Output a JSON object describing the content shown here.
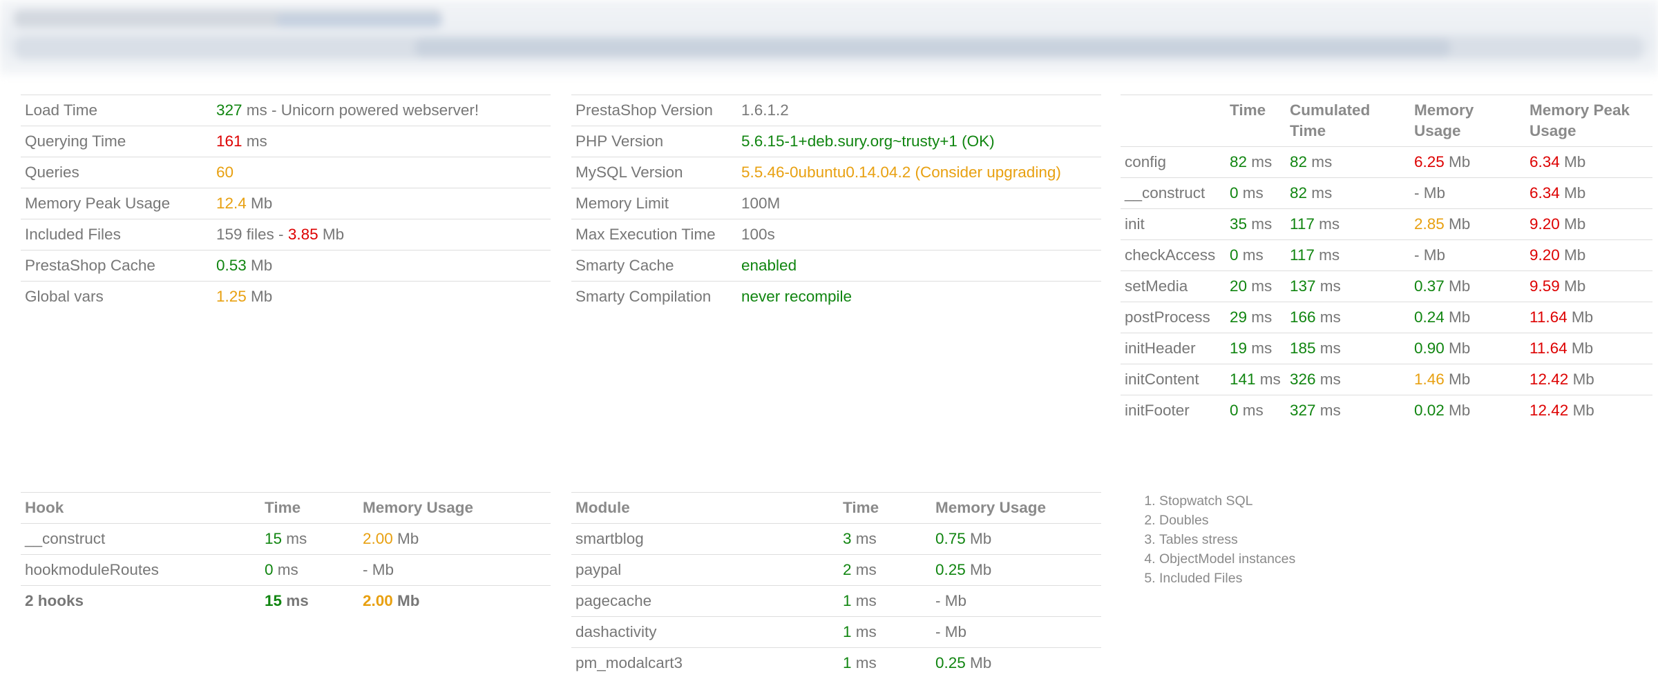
{
  "summary": [
    {
      "label": "Load Time",
      "parts": [
        {
          "t": "327",
          "c": "g"
        },
        {
          "t": " ms - Unicorn powered webserver!",
          "c": ""
        }
      ]
    },
    {
      "label": "Querying Time",
      "parts": [
        {
          "t": "161",
          "c": "r"
        },
        {
          "t": " ms",
          "c": ""
        }
      ]
    },
    {
      "label": "Queries",
      "parts": [
        {
          "t": "60",
          "c": "o"
        }
      ]
    },
    {
      "label": "Memory Peak Usage",
      "parts": [
        {
          "t": "12.4",
          "c": "o"
        },
        {
          "t": " Mb",
          "c": ""
        }
      ]
    },
    {
      "label": "Included Files",
      "parts": [
        {
          "t": "159 files - ",
          "c": ""
        },
        {
          "t": "3.85",
          "c": "r"
        },
        {
          "t": " Mb",
          "c": ""
        }
      ]
    },
    {
      "label": "PrestaShop Cache",
      "parts": [
        {
          "t": "0.53",
          "c": "g"
        },
        {
          "t": " Mb",
          "c": ""
        }
      ]
    },
    {
      "label": "Global vars",
      "parts": [
        {
          "t": "1.25",
          "c": "o"
        },
        {
          "t": " Mb",
          "c": ""
        }
      ]
    }
  ],
  "env": [
    {
      "label": "PrestaShop Version",
      "value": "1.6.1.2",
      "c": ""
    },
    {
      "label": "PHP Version",
      "value": "5.6.15-1+deb.sury.org~trusty+1 (OK)",
      "c": "g"
    },
    {
      "label": "MySQL Version",
      "value": "5.5.46-0ubuntu0.14.04.2 (Consider upgrading)",
      "c": "o"
    },
    {
      "label": "Memory Limit",
      "value": "100M",
      "c": ""
    },
    {
      "label": "Max Execution Time",
      "value": "100s",
      "c": ""
    },
    {
      "label": "Smarty Cache",
      "value": "enabled",
      "c": "g"
    },
    {
      "label": "Smarty Compilation",
      "value": "never recompile",
      "c": "g"
    }
  ],
  "controller": {
    "headers": [
      "",
      "Time",
      "Cumulated Time",
      "Memory Usage",
      "Memory Peak Usage"
    ],
    "rows": [
      {
        "name": "config",
        "time": "82",
        "tc": "g",
        "cum": "82",
        "cc": "g",
        "mem": "6.25",
        "mc": "r",
        "peak": "6.34",
        "pc": "r"
      },
      {
        "name": "__construct",
        "time": "0",
        "tc": "g",
        "cum": "82",
        "cc": "g",
        "mem": "-",
        "mc": "",
        "peak": "6.34",
        "pc": "r"
      },
      {
        "name": "init",
        "time": "35",
        "tc": "g",
        "cum": "117",
        "cc": "g",
        "mem": "2.85",
        "mc": "o",
        "peak": "9.20",
        "pc": "r"
      },
      {
        "name": "checkAccess",
        "time": "0",
        "tc": "g",
        "cum": "117",
        "cc": "g",
        "mem": "-",
        "mc": "",
        "peak": "9.20",
        "pc": "r"
      },
      {
        "name": "setMedia",
        "time": "20",
        "tc": "g",
        "cum": "137",
        "cc": "g",
        "mem": "0.37",
        "mc": "g",
        "peak": "9.59",
        "pc": "r"
      },
      {
        "name": "postProcess",
        "time": "29",
        "tc": "g",
        "cum": "166",
        "cc": "g",
        "mem": "0.24",
        "mc": "g",
        "peak": "11.64",
        "pc": "r"
      },
      {
        "name": "initHeader",
        "time": "19",
        "tc": "g",
        "cum": "185",
        "cc": "g",
        "mem": "0.90",
        "mc": "g",
        "peak": "11.64",
        "pc": "r"
      },
      {
        "name": "initContent",
        "time": "141",
        "tc": "g",
        "cum": "326",
        "cc": "g",
        "mem": "1.46",
        "mc": "o",
        "peak": "12.42",
        "pc": "r"
      },
      {
        "name": "initFooter",
        "time": "0",
        "tc": "g",
        "cum": "327",
        "cc": "g",
        "mem": "0.02",
        "mc": "g",
        "peak": "12.42",
        "pc": "r"
      }
    ]
  },
  "hooks": {
    "headers": [
      "Hook",
      "Time",
      "Memory Usage"
    ],
    "rows": [
      {
        "name": "__construct",
        "time": "15",
        "tc": "g",
        "mem": "2.00",
        "mc": "o"
      },
      {
        "name": "hookmoduleRoutes",
        "time": "0",
        "tc": "g",
        "mem": "-",
        "mc": ""
      }
    ],
    "total": {
      "name": "2 hooks",
      "time": "15",
      "tc": "g",
      "mem": "2.00",
      "mc": "o"
    }
  },
  "modules": {
    "headers": [
      "Module",
      "Time",
      "Memory Usage"
    ],
    "rows": [
      {
        "name": "smartblog",
        "time": "3",
        "tc": "g",
        "mem": "0.75",
        "mc": "g"
      },
      {
        "name": "paypal",
        "time": "2",
        "tc": "g",
        "mem": "0.25",
        "mc": "g"
      },
      {
        "name": "pagecache",
        "time": "1",
        "tc": "g",
        "mem": "-",
        "mc": ""
      },
      {
        "name": "dashactivity",
        "time": "1",
        "tc": "g",
        "mem": "-",
        "mc": ""
      },
      {
        "name": "pm_modalcart3",
        "time": "1",
        "tc": "g",
        "mem": "0.25",
        "mc": "g"
      }
    ]
  },
  "units": {
    "ms": " ms",
    "mb": " Mb"
  },
  "links": [
    "Stopwatch SQL",
    "Doubles",
    "Tables stress",
    "ObjectModel instances",
    "Included Files"
  ],
  "colors": {
    "green": "#108510",
    "orange": "#e8a010",
    "red": "#dd0000",
    "text": "#777777",
    "border": "#dddddd"
  }
}
